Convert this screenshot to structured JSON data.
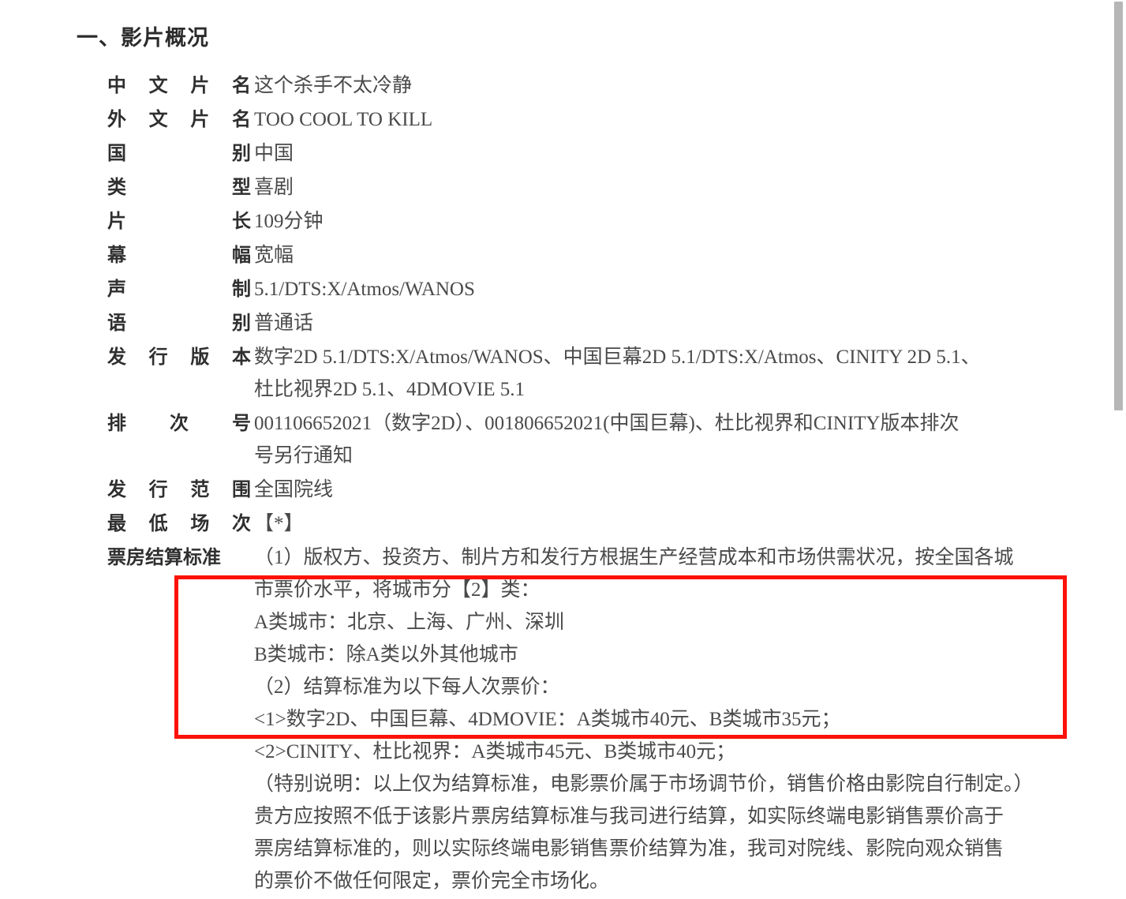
{
  "document": {
    "section_title": "一、影片概况"
  },
  "fields": [
    {
      "label": "中文片名",
      "label_chars": [
        "中",
        "文",
        "片",
        "名"
      ],
      "value_lines": [
        "这个杀手不太冷静"
      ]
    },
    {
      "label": "外文片名",
      "label_chars": [
        "外",
        "文",
        "片",
        "名"
      ],
      "value_lines": [
        "TOO COOL TO KILL"
      ]
    },
    {
      "label": "国别",
      "label_chars": [
        "国",
        "别"
      ],
      "value_lines": [
        "中国"
      ]
    },
    {
      "label": "类型",
      "label_chars": [
        "类",
        "型"
      ],
      "value_lines": [
        "喜剧"
      ]
    },
    {
      "label": "片长",
      "label_chars": [
        "片",
        "长"
      ],
      "value_lines": [
        "109分钟"
      ]
    },
    {
      "label": "幕幅",
      "label_chars": [
        "幕",
        "幅"
      ],
      "value_lines": [
        "宽幅"
      ]
    },
    {
      "label": "声制",
      "label_chars": [
        "声",
        "制"
      ],
      "value_lines": [
        "5.1/DTS:X/Atmos/WANOS"
      ]
    },
    {
      "label": "语别",
      "label_chars": [
        "语",
        "别"
      ],
      "value_lines": [
        "普通话"
      ]
    },
    {
      "label": "发行版本",
      "label_chars": [
        "发",
        "行",
        "版",
        "本"
      ],
      "value_lines": [
        "数字2D 5.1/DTS:X/Atmos/WANOS、中国巨幕2D 5.1/DTS:X/Atmos、CINITY 2D 5.1、",
        "杜比视界2D 5.1、4DMOVIE  5.1"
      ]
    },
    {
      "label": "排次号",
      "label_chars": [
        "排",
        "次",
        "号"
      ],
      "value_lines": [
        "001106652021（数字2D）、001806652021(中国巨幕)、杜比视界和CINITY版本排次",
        "号另行通知"
      ]
    },
    {
      "label": "发行范围",
      "label_chars": [
        "发",
        "行",
        "范",
        "围"
      ],
      "value_lines": [
        "全国院线"
      ]
    },
    {
      "label": "最低场次",
      "label_chars": [
        "最",
        "低",
        "场",
        "次"
      ],
      "value_lines": [
        "【*】"
      ]
    }
  ],
  "settlement": {
    "label": "票房结算标准",
    "lines": [
      "（1）版权方、投资方、制片方和发行方根据生产经营成本和市场供需状况，按全国各城",
      "市票价水平，将城市分【2】类：",
      "A类城市：北京、上海、广州、深圳",
      "B类城市：除A类以外其他城市",
      "（2）结算标准为以下每人次票价：",
      "<1>数字2D、中国巨幕、4DMOVIE：A类城市40元、B类城市35元；",
      "<2>CINITY、杜比视界：A类城市45元、B类城市40元；",
      "（特别说明：以上仅为结算标准，电影票价属于市场调节价，销售价格由影院自行制定。）",
      "贵方应按照不低于该影片票房结算标准与我司进行结算，如实际终端电影销售票价高于",
      "票房结算标准的，则以实际终端电影销售票价结算为准，我司对院线、影院向观众销售",
      "的票价不做任何限定，票价完全市场化。"
    ]
  },
  "annotation": {
    "highlight_color": "#fc1208",
    "highlight_note": "red-rectangle-around-settlement-prices"
  },
  "scrollbar": {
    "thumb_color": "#b6b6b6"
  }
}
